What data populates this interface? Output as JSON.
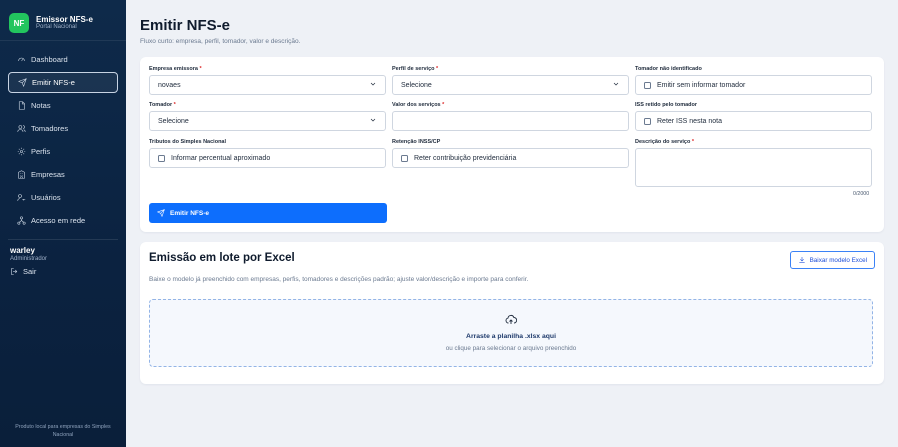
{
  "brand": {
    "logo": "NF",
    "title": "Emissor NFS-e",
    "subtitle": "Portal Nacional"
  },
  "nav": [
    {
      "label": "Dashboard",
      "icon": "gauge-icon"
    },
    {
      "label": "Emitir NFS-e",
      "icon": "send-icon",
      "active": true
    },
    {
      "label": "Notas",
      "icon": "file-icon"
    },
    {
      "label": "Tomadores",
      "icon": "users-icon"
    },
    {
      "label": "Perfis",
      "icon": "gear-icon"
    },
    {
      "label": "Empresas",
      "icon": "building-icon"
    },
    {
      "label": "Usuários",
      "icon": "user-key-icon"
    },
    {
      "label": "Acesso em rede",
      "icon": "network-icon"
    }
  ],
  "user": {
    "name": "warley",
    "role": "Administrador",
    "logout": "Sair"
  },
  "footnote": "Produto local para empresas do Simples Nacional",
  "page": {
    "title": "Emitir NFS-e",
    "subtitle": "Fluxo curto: empresa, perfil, tomador, valor e descrição."
  },
  "form": {
    "empresa": {
      "label": "Empresa emissora",
      "value": "novaes"
    },
    "perfil": {
      "label": "Perfil de serviço",
      "value": "Selecione"
    },
    "tomador_nao": {
      "label": "Tomador não identificado",
      "check": "Emitir sem informar tomador"
    },
    "tomador": {
      "label": "Tomador",
      "value": "Selecione"
    },
    "valor": {
      "label": "Valor dos serviços",
      "value": ""
    },
    "iss": {
      "label": "ISS retido pelo tomador",
      "check": "Reter ISS nesta nota"
    },
    "tributos": {
      "label": "Tributos do Simples Nacional",
      "check": "Informar percentual aproximado"
    },
    "retencao": {
      "label": "Retenção INSS/CP",
      "check": "Reter contribuição previdenciária"
    },
    "descricao": {
      "label": "Descrição do serviço",
      "counter": "0/2000"
    },
    "submit": "Emitir NFS-e"
  },
  "lote": {
    "title": "Emissão em lote por Excel",
    "description": "Baixe o modelo já preenchido com empresas, perfis, tomadores e descrições padrão; ajuste valor/descrição e importe para conferir.",
    "download": "Baixar modelo Excel",
    "drop_title": "Arraste a planilha .xlsx aqui",
    "drop_sub": "ou clique para selecionar o arquivo preenchido"
  }
}
